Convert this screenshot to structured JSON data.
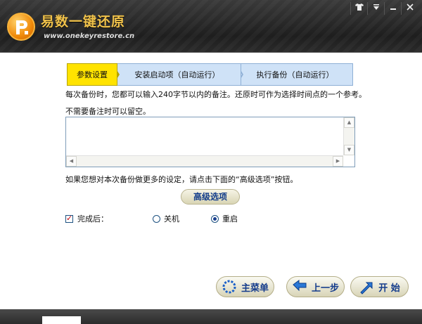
{
  "app": {
    "title": "易数一键还原",
    "url": "www.onekeyrestore.cn"
  },
  "window_controls": [
    "shirt-icon",
    "menu-icon",
    "minimize-icon",
    "close-icon"
  ],
  "steps": [
    {
      "label": "参数设置",
      "active": true
    },
    {
      "label": "安装启动项（自动运行）",
      "active": false
    },
    {
      "label": "执行备份（自动运行）",
      "active": false
    }
  ],
  "main": {
    "intro": "每次备份时，您都可以输入240字节以内的备注。还原时可作为选择时间点的一个参考。",
    "blank_hint": "不需要备注时可以留空。",
    "note_value": "",
    "advanced_hint": "如果您想对本次备份做更多的设定，请点击下面的“高级选项”按钮。",
    "advanced_button": "高级选项"
  },
  "after_done": {
    "label": "完成后：",
    "checked": true,
    "options": [
      {
        "label": "关机",
        "selected": false
      },
      {
        "label": "重启",
        "selected": true
      }
    ]
  },
  "buttons": {
    "main_menu": "主菜单",
    "prev_step": "上一步",
    "start": "开 始"
  },
  "colors": {
    "active_step": "#ffe300",
    "inactive_step": "#cfe2f7",
    "title_gold": "#f0c24b",
    "button_text": "#143c8c"
  }
}
